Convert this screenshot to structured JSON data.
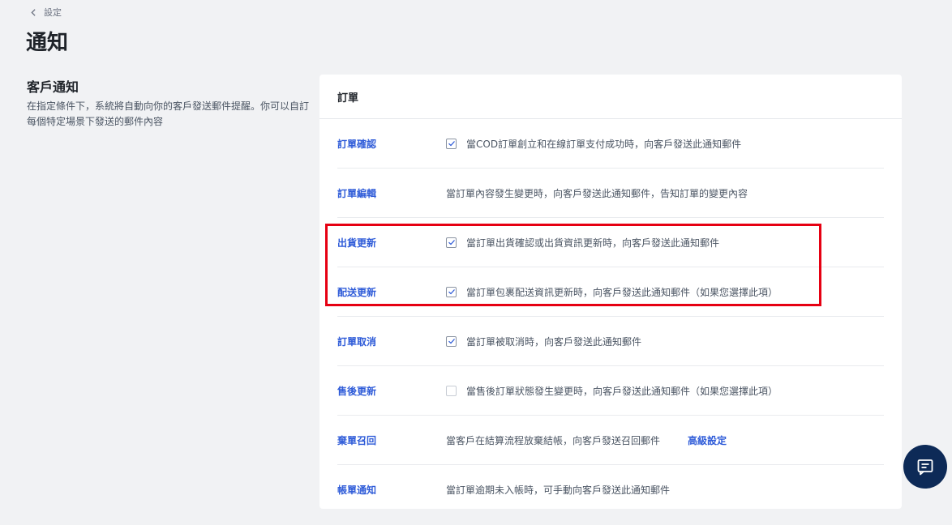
{
  "breadcrumb": {
    "label": "設定",
    "icon": "chevron-left-icon"
  },
  "page_title": "通知",
  "section": {
    "title": "客戶通知",
    "description": "在指定條件下，系統將自動向你的客戶發送郵件提醒。你可以自訂每個特定場景下發送的郵件內容"
  },
  "card": {
    "title": "訂單",
    "rows": [
      {
        "label": "訂單確認",
        "checkbox": "checked",
        "description": "當COD訂單創立和在線訂單支付成功時，向客戶發送此通知郵件"
      },
      {
        "label": "訂單編輯",
        "checkbox": "none",
        "description": "當訂單內容發生變更時，向客戶發送此通知郵件，告知訂單的變更內容"
      },
      {
        "label": "出貨更新",
        "checkbox": "checked",
        "description": "當訂單出貨確認或出貨資訊更新時，向客戶發送此通知郵件"
      },
      {
        "label": "配送更新",
        "checkbox": "checked",
        "description": "當訂單包裹配送資訊更新時，向客戶發送此通知郵件（如果您選擇此項）"
      },
      {
        "label": "訂單取消",
        "checkbox": "checked",
        "description": "當訂單被取消時，向客戶發送此通知郵件"
      },
      {
        "label": "售後更新",
        "checkbox": "unchecked",
        "description": "當售後訂單狀態發生變更時，向客戶發送此通知郵件（如果您選擇此項）"
      },
      {
        "label": "棄單召回",
        "checkbox": "none",
        "description": "當客戶在結算流程放棄結帳，向客戶發送召回郵件",
        "link": "高級設定"
      },
      {
        "label": "帳單通知",
        "checkbox": "none",
        "description": "當訂單逾期未入帳時，可手動向客戶發送此通知郵件"
      }
    ]
  },
  "colors": {
    "link": "#2e5bd8",
    "highlight": "#e60012",
    "chat_button": "#0d2a57"
  },
  "chat_button": {
    "icon": "chat-icon"
  }
}
